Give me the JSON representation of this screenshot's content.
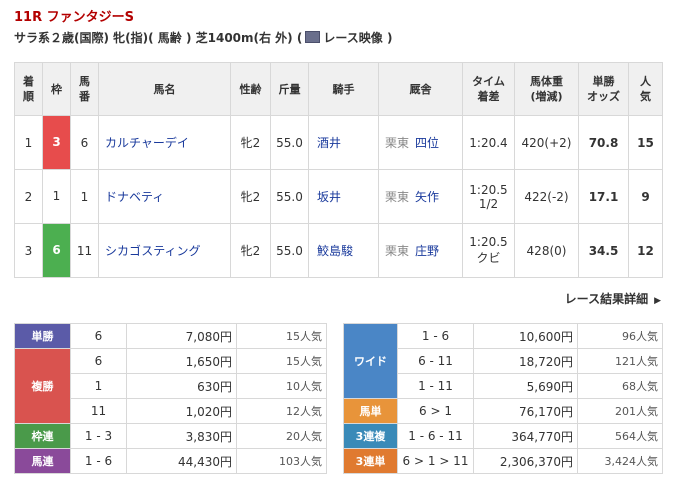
{
  "race": {
    "title": "11R ファンタジーS",
    "conditions": "サラ系２歳(国際) 牝(指)( 馬齢 ) 芝1400m(右 外)  (",
    "video_label": "レース映像",
    "conditions_close": ")"
  },
  "results": {
    "headers": [
      "着順",
      "枠",
      "馬番",
      "馬名",
      "性齢",
      "斤量",
      "騎手",
      "厩舎",
      "タイム着差",
      "馬体重(増減)",
      "単勝オッズ",
      "人気"
    ],
    "headers_split": {
      "rank": [
        "着",
        "順"
      ],
      "waku": "枠",
      "umaban": [
        "馬",
        "番"
      ],
      "name": "馬名",
      "sexage": "性齢",
      "weight": "斤量",
      "jockey": "騎手",
      "trainer": "厩舎",
      "time": [
        "タイム",
        "着差"
      ],
      "body": [
        "馬体重",
        "(増減)"
      ],
      "odds": [
        "単勝",
        "オッズ"
      ],
      "pop": [
        "人",
        "気"
      ]
    },
    "rows": [
      {
        "rank": "1",
        "waku": "3",
        "waku_color": "#e74c4c",
        "umaban": "6",
        "name": "カルチャーデイ",
        "sexage": "牝2",
        "weight": "55.0",
        "jockey": "酒井",
        "belong": "栗東",
        "trainer": "四位",
        "time": "1:20.4",
        "margin": "",
        "body": "420(+2)",
        "odds": "70.8",
        "pop": "15"
      },
      {
        "rank": "2",
        "waku": "1",
        "waku_color": "#ffffff",
        "umaban": "1",
        "name": "ドナベティ",
        "sexage": "牝2",
        "weight": "55.0",
        "jockey": "坂井",
        "belong": "栗東",
        "trainer": "矢作",
        "time": "1:20.5",
        "margin": "1/2",
        "body": "422(-2)",
        "odds": "17.1",
        "pop": "9"
      },
      {
        "rank": "3",
        "waku": "6",
        "waku_color": "#4caf50",
        "umaban": "11",
        "name": "シカゴスティング",
        "sexage": "牝2",
        "weight": "55.0",
        "jockey": "鮫島駿",
        "belong": "栗東",
        "trainer": "庄野",
        "time": "1:20.5",
        "margin": "クビ",
        "body": "428(0)",
        "odds": "34.5",
        "pop": "12"
      }
    ],
    "detail_link": "レース結果詳細"
  },
  "payouts_left": [
    {
      "label": "単勝",
      "rows": [
        {
          "combo": "6",
          "yen": "7,080円",
          "ninki": "15人気"
        }
      ]
    },
    {
      "label": "複勝",
      "rows": [
        {
          "combo": "6",
          "yen": "1,650円",
          "ninki": "15人気"
        },
        {
          "combo": "1",
          "yen": "630円",
          "ninki": "10人気"
        },
        {
          "combo": "11",
          "yen": "1,020円",
          "ninki": "12人気"
        }
      ]
    },
    {
      "label": "枠連",
      "rows": [
        {
          "combo": "1 - 3",
          "yen": "3,830円",
          "ninki": "20人気"
        }
      ]
    },
    {
      "label": "馬連",
      "rows": [
        {
          "combo": "1 - 6",
          "yen": "44,430円",
          "ninki": "103人気"
        }
      ]
    }
  ],
  "payouts_right": [
    {
      "label": "ワイド",
      "rows": [
        {
          "combo": "1 - 6",
          "yen": "10,600円",
          "ninki": "96人気"
        },
        {
          "combo": "6 - 11",
          "yen": "18,720円",
          "ninki": "121人気"
        },
        {
          "combo": "1 - 11",
          "yen": "5,690円",
          "ninki": "68人気"
        }
      ]
    },
    {
      "label": "馬単",
      "rows": [
        {
          "combo": "6 > 1",
          "yen": "76,170円",
          "ninki": "201人気"
        }
      ]
    },
    {
      "label": "3連複",
      "rows": [
        {
          "combo": "1 - 6 - 11",
          "yen": "364,770円",
          "ninki": "564人気"
        }
      ]
    },
    {
      "label": "3連単",
      "rows": [
        {
          "combo": "6 > 1 > 11",
          "yen": "2,306,370円",
          "ninki": "3,424人気"
        }
      ]
    }
  ]
}
